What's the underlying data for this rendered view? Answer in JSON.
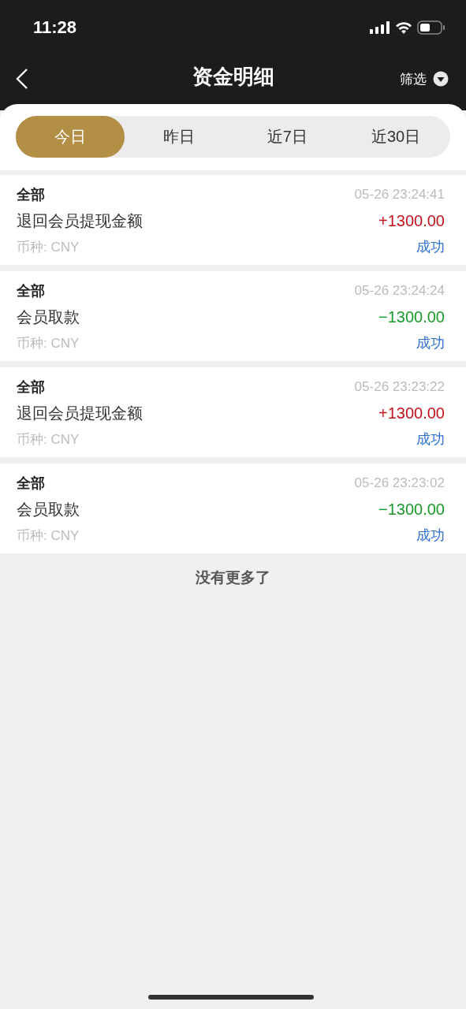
{
  "status_bar": {
    "time": "11:28"
  },
  "nav": {
    "title": "资金明细",
    "filter": "筛选"
  },
  "tabs": [
    {
      "label": "今日",
      "selected": true
    },
    {
      "label": "昨日",
      "selected": false
    },
    {
      "label": "近7日",
      "selected": false
    },
    {
      "label": "近30日",
      "selected": false
    }
  ],
  "records": [
    {
      "category": "全部",
      "time": "05-26 23:24:41",
      "description": "退回会员提现金额",
      "amount": "+1300.00",
      "color": "#c0141c",
      "currency": "币种: CNY",
      "status": "成功"
    },
    {
      "category": "全部",
      "time": "05-26 23:24:24",
      "description": "会员取款",
      "amount": "−1300.00",
      "color": "#1a9a2a",
      "currency": "币种: CNY",
      "status": "成功"
    },
    {
      "category": "全部",
      "time": "05-26 23:23:22",
      "description": "退回会员提现金额",
      "amount": "+1300.00",
      "color": "#c0141c",
      "currency": "币种: CNY",
      "status": "成功"
    },
    {
      "category": "全部",
      "time": "05-26 23:23:02",
      "description": "会员取款",
      "amount": "−1300.00",
      "color": "#1a9a2a",
      "currency": "币种: CNY",
      "status": "成功"
    }
  ],
  "footer": "没有更多了"
}
